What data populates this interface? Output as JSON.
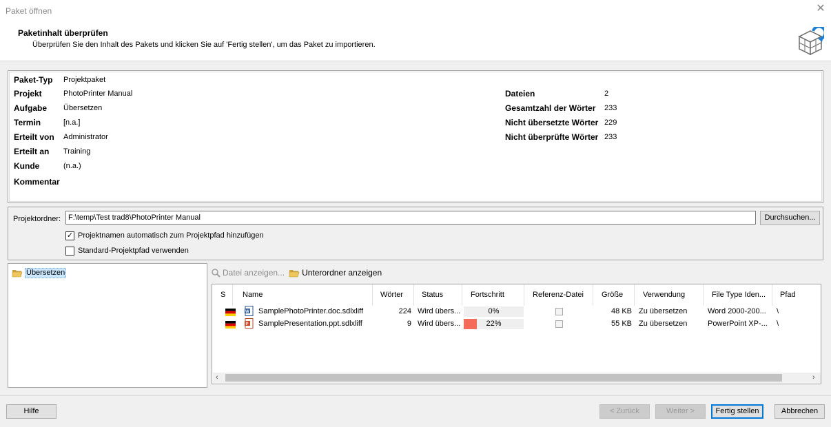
{
  "window": {
    "title": "Paket öffnen",
    "close_glyph": "✕"
  },
  "header": {
    "title": "Paketinhalt überprüfen",
    "subtitle": "Überprüfen Sie den Inhalt des Pakets und klicken Sie auf 'Fertig stellen', um das Paket zu importieren.",
    "icon": "package-cube-icon"
  },
  "info": {
    "left": [
      {
        "label": "Paket-Typ",
        "value": "Projektpaket"
      },
      {
        "label": "Projekt",
        "value": "PhotoPrinter Manual"
      },
      {
        "label": "Aufgabe",
        "value": "Übersetzen"
      },
      {
        "label": "Termin",
        "value": "[n.a.]"
      },
      {
        "label": "Erteilt von",
        "value": "Administrator"
      },
      {
        "label": "Erteilt an",
        "value": "Training"
      },
      {
        "label": "Kunde",
        "value": "(n.a.)"
      },
      {
        "label": "Kommentar",
        "value": ""
      }
    ],
    "right": [
      {
        "label": "Dateien",
        "value": "2"
      },
      {
        "label": "Gesamtzahl der Wörter",
        "value": "233"
      },
      {
        "label": "Nicht übersetzte Wörter",
        "value": "229"
      },
      {
        "label": "Nicht überprüfte Wörter",
        "value": "233"
      }
    ]
  },
  "project_folder": {
    "label": "Projektordner:",
    "value": "F:\\temp\\Test trad8\\PhotoPrinter Manual",
    "browse_label": "Durchsuchen...",
    "option1": {
      "label": "Projektnamen automatisch zum Projektpfad hinzufügen",
      "checked": true
    },
    "option2": {
      "label": "Standard-Projektpfad verwenden",
      "checked": false
    }
  },
  "tree": {
    "item": "Übersetzen"
  },
  "toolbar": {
    "show_file": "Datei anzeigen...",
    "show_subfolder": "Unterordner anzeigen"
  },
  "grid": {
    "columns": [
      "S",
      "Name",
      "Wörter",
      "Status",
      "Fortschritt",
      "Referenz-Datei",
      "Größe",
      "Verwendung",
      "File Type Iden...",
      "Pfad"
    ],
    "rows": [
      {
        "name": "SamplePhotoPrinter.doc.sdlxliff",
        "words": "224",
        "status": "Wird übers...",
        "progress_text": "0%",
        "progress": 0,
        "size": "48 KB",
        "usage": "Zu übersetzen",
        "filetype": "Word  2000-200...",
        "path": "\\",
        "file_icon": "word-file-icon"
      },
      {
        "name": "SamplePresentation.ppt.sdlxliff",
        "words": "9",
        "status": "Wird übers...",
        "progress_text": "22%",
        "progress": 0.22,
        "size": "55 KB",
        "usage": "Zu übersetzen",
        "filetype": "PowerPoint XP-...",
        "path": "\\",
        "file_icon": "powerpoint-file-icon"
      }
    ]
  },
  "footer": {
    "help": "Hilfe",
    "back": "< Zurück",
    "next": "Weiter >",
    "finish": "Fertig stellen",
    "cancel": "Abbrechen"
  },
  "colors": {
    "progress_fill": "#f46b5a",
    "selection": "#cce8ff",
    "accent": "#0078d7"
  }
}
